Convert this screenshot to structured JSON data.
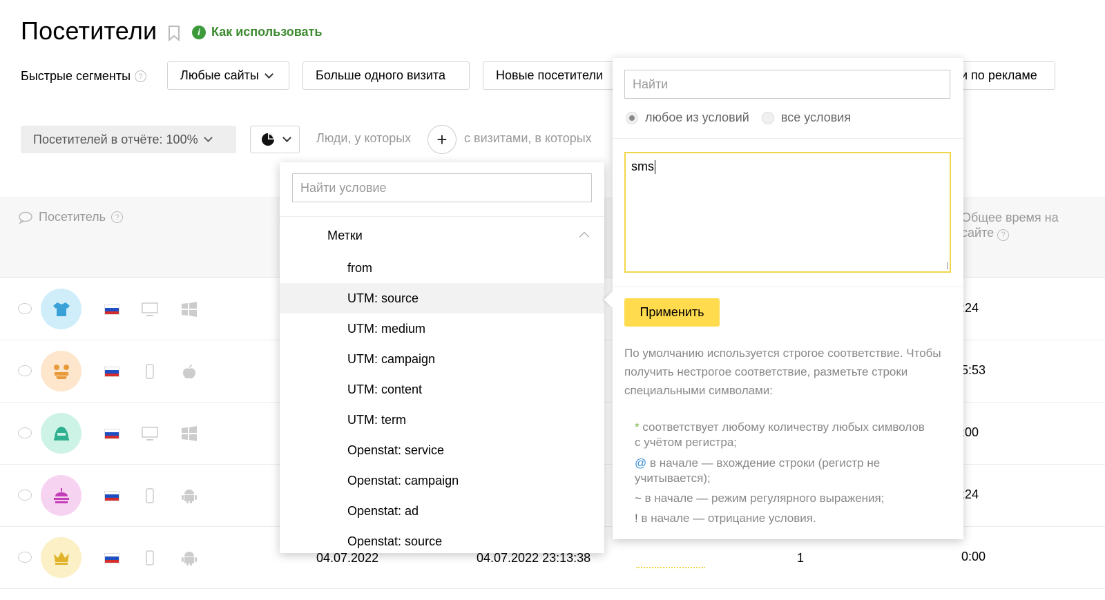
{
  "page": {
    "title": "Посетители",
    "how_to": "Как использовать",
    "info_glyph": "i",
    "qmark_glyph": "?"
  },
  "quick_segments": {
    "label": "Быстрые сегменты",
    "buttons": [
      "Любые сайты",
      "Больше одного визита",
      "Новые посетители",
      "и по рекламе"
    ]
  },
  "filters": {
    "report_share": "Посетителей в отчёте: 100%",
    "people_label": "Люди, у которых",
    "plus": "+",
    "visits_label": "с визитами, в которых"
  },
  "table": {
    "col_visitor": "Посетитель",
    "col_total_time": "Общее время на сайте",
    "rows": [
      {
        "avatar_color": "#cfeefa",
        "icon_color": "#3aa0d8",
        "device": "desktop",
        "os": "windows",
        "time": ":24"
      },
      {
        "avatar_color": "#fde6cc",
        "icon_color": "#e89a3a",
        "device": "mobile",
        "os": "apple",
        "time": "5:53"
      },
      {
        "avatar_color": "#cdf2e6",
        "icon_color": "#2fb08e",
        "device": "desktop",
        "os": "windows",
        "time": ":00"
      },
      {
        "avatar_color": "#f7d3f2",
        "icon_color": "#c43db8",
        "device": "mobile",
        "os": "android",
        "time": ":24"
      },
      {
        "avatar_color": "#fcf0c7",
        "icon_color": "#e0b32a",
        "device": "mobile",
        "os": "android",
        "time": "0:00",
        "first_visit": "04.07.2022",
        "last_visit": "04.07.2022 23:13:38",
        "visits": "1"
      }
    ]
  },
  "condition_dropdown": {
    "search_placeholder": "Найти условие",
    "group": "Метки",
    "options": [
      "from",
      "UTM: source",
      "UTM: medium",
      "UTM: campaign",
      "UTM: content",
      "UTM: term",
      "Openstat: service",
      "Openstat: campaign",
      "Openstat: ad",
      "Openstat: source"
    ],
    "highlighted_index": 1
  },
  "value_panel": {
    "search_placeholder": "Найти",
    "radio_any": "любое из условий",
    "radio_all": "все условия",
    "textarea_value": "sms",
    "apply": "Применить",
    "hint": "По умолчанию используется строгое соответствие. Чтобы получить нестрогое соответствие, разметьте строки специальными символами:",
    "rules": [
      {
        "sym": "*",
        "text": " соответствует любому количеству любых символов с учётом регистра;"
      },
      {
        "sym": "@",
        "text": " в начале — вхождение строки (регистр не учитывается);"
      },
      {
        "sym": "~",
        "text": " в начале — режим регулярного выражения;"
      },
      {
        "sym": "!",
        "text": " в начале — отрицание условия."
      }
    ]
  },
  "colors": {
    "accent_green": "#3c8a2e",
    "apply_yellow": "#ffdb4d",
    "focus_border": "#f2d64a"
  }
}
